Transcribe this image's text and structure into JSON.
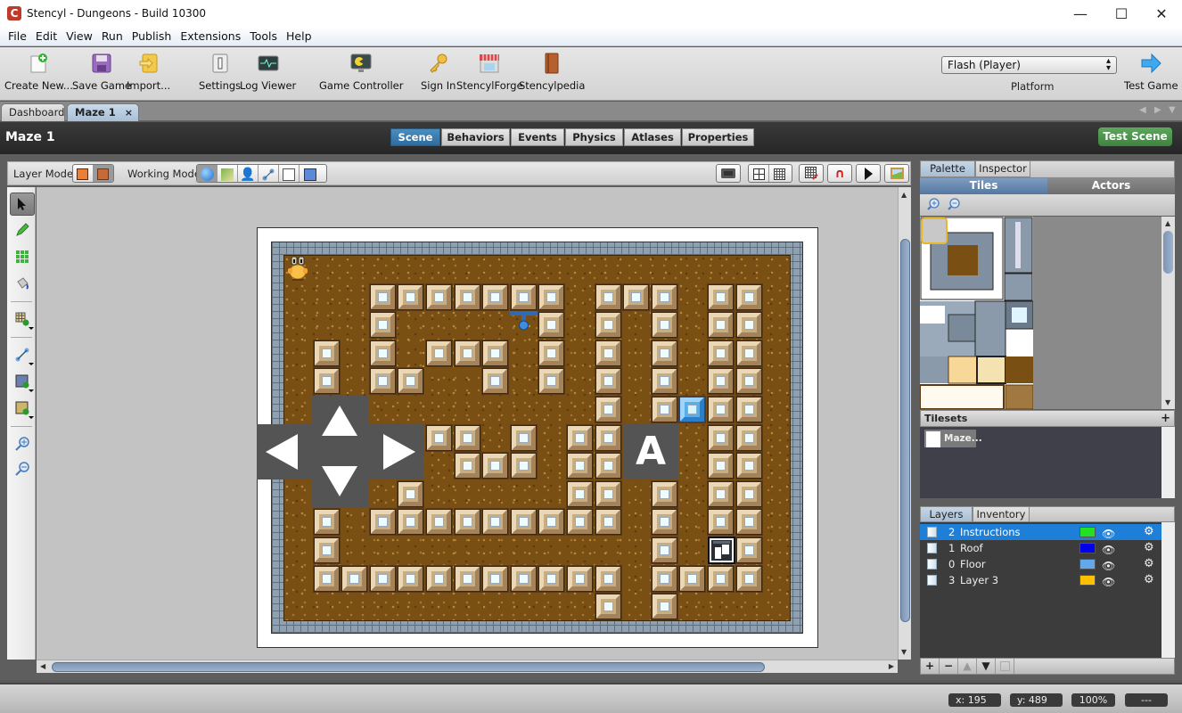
{
  "window": {
    "title": "Stencyl - Dungeons - Build 10300",
    "logo": "C",
    "minimize": "—",
    "maximize": "☐",
    "close": "✕"
  },
  "menu": [
    "File",
    "Edit",
    "View",
    "Run",
    "Publish",
    "Extensions",
    "Tools",
    "Help"
  ],
  "toolbar": {
    "items": [
      {
        "label": "Create New...",
        "icon": "create-new-icon"
      },
      {
        "label": "Save Game",
        "icon": "save-icon"
      },
      {
        "label": "Import...",
        "icon": "import-icon"
      },
      {
        "label": "Settings",
        "icon": "settings-icon"
      },
      {
        "label": "Log Viewer",
        "icon": "log-viewer-icon"
      },
      {
        "label": "Game Controller",
        "icon": "game-controller-icon"
      },
      {
        "label": "Sign In",
        "icon": "key-icon"
      },
      {
        "label": "StencylForge",
        "icon": "store-icon"
      },
      {
        "label": "Stencylpedia",
        "icon": "book-icon"
      }
    ],
    "platform": {
      "value": "Flash (Player)",
      "label": "Platform"
    },
    "test_game": "Test Game"
  },
  "doc_tabs": {
    "dashboard": "Dashboard",
    "active": "Maze 1",
    "close": "×"
  },
  "scene": {
    "title": "Maze 1",
    "tabs": [
      "Scene",
      "Behaviors",
      "Events",
      "Physics",
      "Atlases",
      "Properties"
    ],
    "active_tab": "Scene",
    "test_scene": "Test Scene"
  },
  "modebar": {
    "layer_mode": "Layer Mode",
    "working_mode": "Working Mode"
  },
  "maze": {
    "cols": 18,
    "rows": 13,
    "blocks": [
      [
        1,
        3
      ],
      [
        1,
        4
      ],
      [
        1,
        5
      ],
      [
        1,
        6
      ],
      [
        1,
        7
      ],
      [
        1,
        8
      ],
      [
        1,
        9
      ],
      [
        1,
        11
      ],
      [
        1,
        12
      ],
      [
        1,
        13
      ],
      [
        1,
        15
      ],
      [
        1,
        16
      ],
      [
        2,
        3
      ],
      [
        2,
        9
      ],
      [
        2,
        11
      ],
      [
        2,
        13
      ],
      [
        2,
        15
      ],
      [
        2,
        16
      ],
      [
        3,
        1
      ],
      [
        3,
        3
      ],
      [
        3,
        5
      ],
      [
        3,
        6
      ],
      [
        3,
        7
      ],
      [
        3,
        9
      ],
      [
        3,
        11
      ],
      [
        3,
        13
      ],
      [
        3,
        15
      ],
      [
        3,
        16
      ],
      [
        4,
        1
      ],
      [
        4,
        3
      ],
      [
        4,
        4
      ],
      [
        4,
        7
      ],
      [
        4,
        9
      ],
      [
        4,
        11
      ],
      [
        4,
        13
      ],
      [
        4,
        15
      ],
      [
        4,
        16
      ],
      [
        5,
        11
      ],
      [
        5,
        13
      ],
      [
        5,
        15
      ],
      [
        5,
        16
      ],
      [
        6,
        5
      ],
      [
        6,
        6
      ],
      [
        6,
        8
      ],
      [
        6,
        10
      ],
      [
        6,
        11
      ],
      [
        6,
        15
      ],
      [
        6,
        16
      ],
      [
        7,
        6
      ],
      [
        7,
        7
      ],
      [
        7,
        8
      ],
      [
        7,
        10
      ],
      [
        7,
        11
      ],
      [
        7,
        15
      ],
      [
        7,
        16
      ],
      [
        8,
        4
      ],
      [
        8,
        10
      ],
      [
        8,
        11
      ],
      [
        8,
        13
      ],
      [
        8,
        15
      ],
      [
        8,
        16
      ],
      [
        9,
        1
      ],
      [
        9,
        3
      ],
      [
        9,
        4
      ],
      [
        9,
        5
      ],
      [
        9,
        6
      ],
      [
        9,
        7
      ],
      [
        9,
        8
      ],
      [
        9,
        9
      ],
      [
        9,
        10
      ],
      [
        9,
        11
      ],
      [
        9,
        13
      ],
      [
        9,
        15
      ],
      [
        9,
        16
      ],
      [
        10,
        1
      ],
      [
        10,
        13
      ],
      [
        10,
        16
      ],
      [
        11,
        1
      ],
      [
        11,
        2
      ],
      [
        11,
        3
      ],
      [
        11,
        4
      ],
      [
        11,
        5
      ],
      [
        11,
        6
      ],
      [
        11,
        7
      ],
      [
        11,
        8
      ],
      [
        11,
        9
      ],
      [
        11,
        10
      ],
      [
        11,
        11
      ],
      [
        11,
        13
      ],
      [
        11,
        14
      ],
      [
        11,
        15
      ],
      [
        11,
        16
      ],
      [
        12,
        11
      ],
      [
        12,
        13
      ]
    ],
    "gems": [
      [
        5,
        14
      ]
    ],
    "actors": [
      {
        "name": "player",
        "cell": [
          0,
          0
        ]
      },
      {
        "name": "door-switch",
        "cell": [
          2,
          8
        ]
      },
      {
        "name": "exit-door",
        "cell": [
          10,
          15
        ]
      }
    ],
    "a_button": "A"
  },
  "palette": {
    "tabs": [
      "Palette",
      "Inspector"
    ],
    "sub_tabs": [
      "Tiles",
      "Actors"
    ],
    "tilesets_header": "Tilesets",
    "tileset_item": "Maze...",
    "add": "+"
  },
  "layers": {
    "tabs": [
      "Layers",
      "Inventory"
    ],
    "rows": [
      {
        "num": "2",
        "name": "Instructions",
        "color": "#22e122",
        "selected": true
      },
      {
        "num": "1",
        "name": "Roof",
        "color": "#0000ee",
        "selected": false
      },
      {
        "num": "0",
        "name": "Floor",
        "color": "#62a8ea",
        "selected": false
      },
      {
        "num": "3",
        "name": "Layer 3",
        "color": "#ffc000",
        "selected": false
      }
    ],
    "buttons": [
      "+",
      "−",
      "▲",
      "▼",
      ""
    ]
  },
  "status": {
    "x": "x:    195",
    "y": "y:    489",
    "zoom": "100%",
    "extra": "---"
  }
}
